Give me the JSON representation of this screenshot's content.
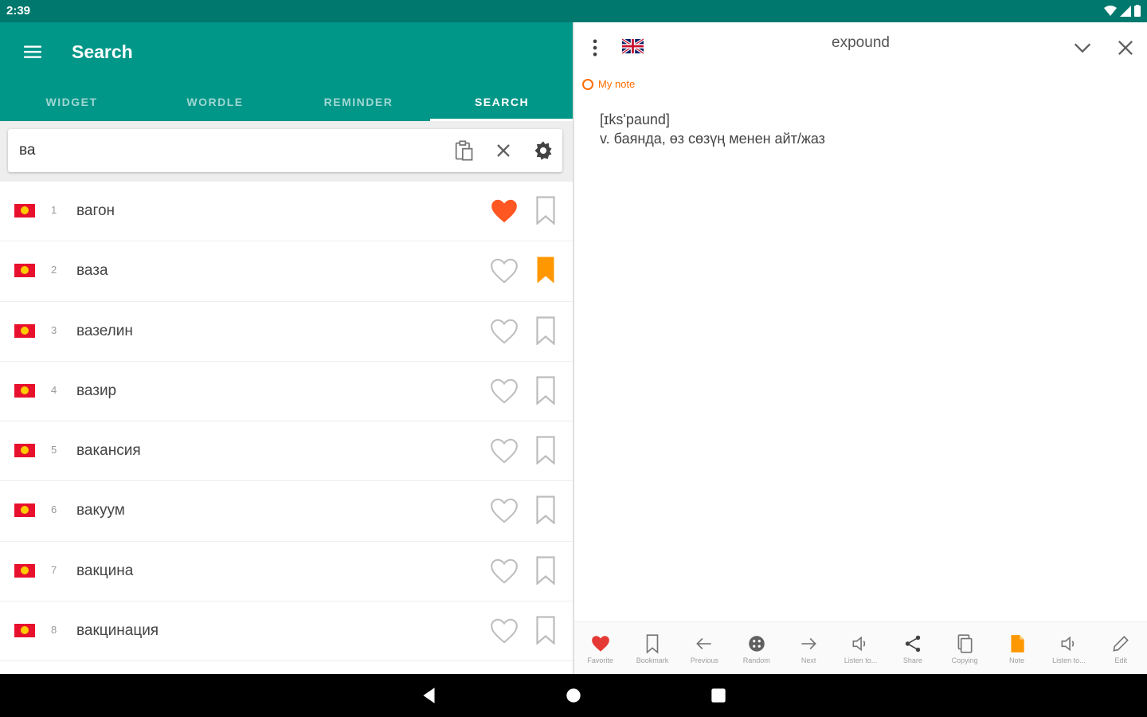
{
  "status": {
    "time": "2:39"
  },
  "left": {
    "title": "Search",
    "tabs": [
      {
        "label": "WIDGET"
      },
      {
        "label": "WORDLE"
      },
      {
        "label": "REMINDER"
      },
      {
        "label": "SEARCH"
      }
    ],
    "search": {
      "value": "ва"
    },
    "results": [
      {
        "num": "1",
        "word": "вагон",
        "favorite": true,
        "bookmarked": false
      },
      {
        "num": "2",
        "word": "ваза",
        "favorite": false,
        "bookmarked": true
      },
      {
        "num": "3",
        "word": "вазелин",
        "favorite": false,
        "bookmarked": false
      },
      {
        "num": "4",
        "word": "вазир",
        "favorite": false,
        "bookmarked": false
      },
      {
        "num": "5",
        "word": "вакансия",
        "favorite": false,
        "bookmarked": false
      },
      {
        "num": "6",
        "word": "вакуум",
        "favorite": false,
        "bookmarked": false
      },
      {
        "num": "7",
        "word": "вакцина",
        "favorite": false,
        "bookmarked": false
      },
      {
        "num": "8",
        "word": "вакцинация",
        "favorite": false,
        "bookmarked": false
      }
    ]
  },
  "right": {
    "title": "expound",
    "note_label": "My note",
    "transcription": "[ɪks'paund]",
    "definition": "v. баянда, өз сөзүң менен айт/жаз",
    "toolbar": [
      {
        "label": "Favorite",
        "icon": "heart-icon"
      },
      {
        "label": "Bookmark",
        "icon": "bookmark-icon"
      },
      {
        "label": "Previous",
        "icon": "arrow-left-icon"
      },
      {
        "label": "Random",
        "icon": "dice-icon"
      },
      {
        "label": "Next",
        "icon": "arrow-right-icon"
      },
      {
        "label": "Listen to...",
        "icon": "speaker-icon"
      },
      {
        "label": "Share",
        "icon": "share-icon"
      },
      {
        "label": "Copying",
        "icon": "copy-icon"
      },
      {
        "label": "Note",
        "icon": "note-icon"
      },
      {
        "label": "Listen to...",
        "icon": "speaker-icon"
      },
      {
        "label": "Edit",
        "icon": "pencil-icon"
      }
    ]
  },
  "colors": {
    "primary": "#009688",
    "status": "#00786e",
    "accent": "#ff6d00",
    "heart": "#ff5722",
    "bookmark": "#ff9800"
  }
}
